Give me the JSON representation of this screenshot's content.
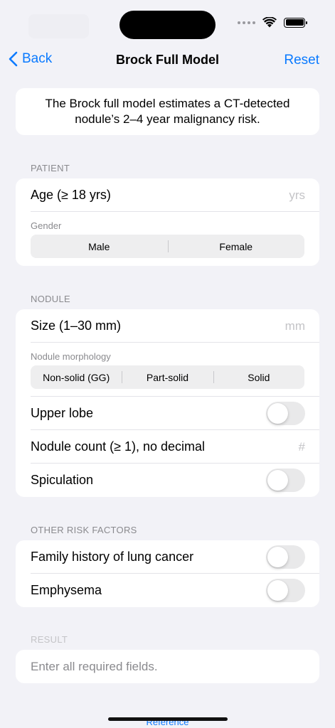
{
  "nav": {
    "back_label": "Back",
    "title": "Brock Full Model",
    "reset_label": "Reset"
  },
  "intro": {
    "text": "The Brock full model estimates a CT-detected nodule’s 2–4 year malignancy risk."
  },
  "patient": {
    "header": "PATIENT",
    "age_label": "Age (≥ 18 yrs)",
    "age_placeholder": "yrs",
    "gender_label": "Gender",
    "gender_options": [
      "Male",
      "Female"
    ]
  },
  "nodule": {
    "header": "NODULE",
    "size_label": "Size (1–30 mm)",
    "size_placeholder": "mm",
    "morphology_label": "Nodule morphology",
    "morphology_options": [
      "Non-solid (GG)",
      "Part-solid",
      "Solid"
    ],
    "upper_lobe_label": "Upper lobe",
    "upper_lobe_on": false,
    "count_label": "Nodule count (≥ 1), no decimal",
    "count_placeholder": "#",
    "spiculation_label": "Spiculation",
    "spiculation_on": false
  },
  "other": {
    "header": "OTHER RISK FACTORS",
    "family_history_label": "Family history of lung cancer",
    "family_history_on": false,
    "emphysema_label": "Emphysema",
    "emphysema_on": false
  },
  "result": {
    "header": "RESULT",
    "text": "Enter all required fields."
  },
  "footer": {
    "reference_label": "Reference"
  },
  "colors": {
    "accent": "#0a7aff",
    "background": "#f2f2f7",
    "toggle_off": "#e9e9ea"
  },
  "icons": {
    "back": "chevron-left-icon",
    "wifi": "wifi-icon",
    "battery": "battery-icon",
    "signal": "signal-dots-icon"
  }
}
